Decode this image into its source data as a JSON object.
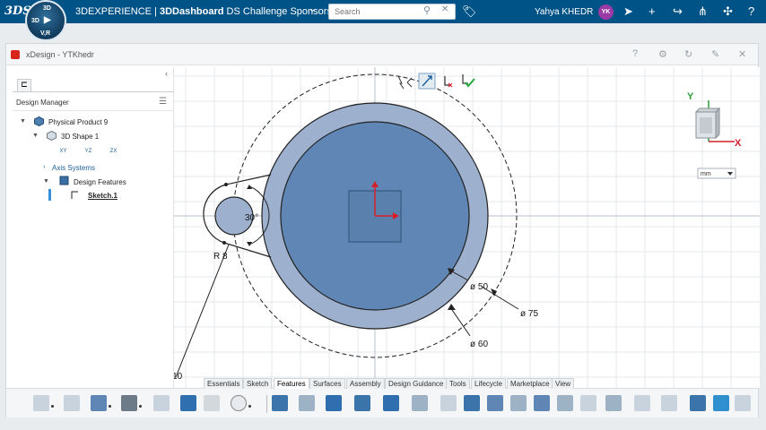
{
  "topbar": {
    "logo": "3DS",
    "compass_top": "3D",
    "compass_left": "3D",
    "compass_bottom": "V,R",
    "brand": "3DEXPERIENCE | ",
    "app": "3DDashboard",
    "dashboard_name": " DS Challenge Sponsors...",
    "search_placeholder": "Search",
    "user_name": "Yahya KHEDR",
    "user_initials": "YK",
    "accent_color": "#005386"
  },
  "panel": {
    "title": "xDesign - YTKhedr"
  },
  "tree": {
    "header": "Design Manager",
    "items": [
      {
        "label": "Physical Product 9"
      },
      {
        "label": "3D Shape 1"
      },
      {
        "label": "Axis Systems"
      },
      {
        "label": "Design Features"
      },
      {
        "label": "Sketch.1"
      }
    ],
    "planes": [
      "XY",
      "YZ",
      "ZX"
    ]
  },
  "sketch": {
    "dims": {
      "d50": "ø 50",
      "d75": "ø 75",
      "d60": "ø 60",
      "r8": "R 8",
      "angle": "30°",
      "ten": "- 10"
    },
    "axis_y": "Y",
    "axis_x": "X",
    "unit": "mm",
    "fill_color": "#5f86b4",
    "ring_color": "#9db1cf"
  },
  "tabs": [
    {
      "label": "Essentials"
    },
    {
      "label": "Sketch"
    },
    {
      "label": "Features"
    },
    {
      "label": "Surfaces"
    },
    {
      "label": "Assembly"
    },
    {
      "label": "Design Guidance"
    },
    {
      "label": "Tools"
    },
    {
      "label": "Lifecycle"
    },
    {
      "label": "Marketplace"
    },
    {
      "label": "View"
    }
  ]
}
